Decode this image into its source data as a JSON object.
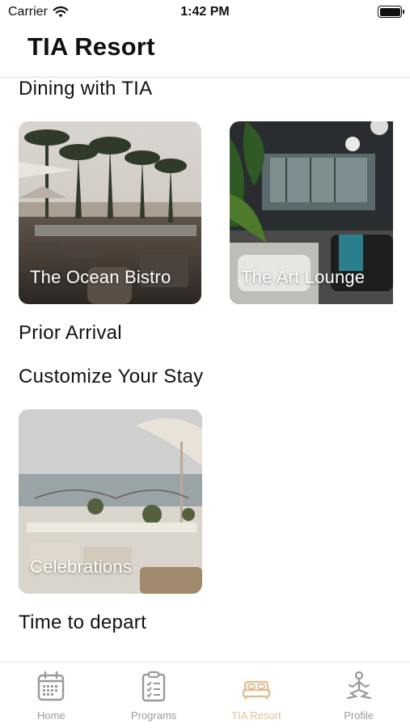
{
  "status_bar": {
    "carrier": "Carrier",
    "time": "1:42 PM"
  },
  "header": {
    "title": "TIA Resort"
  },
  "sections": {
    "dining": {
      "title": "Dining with TIA",
      "cards": [
        {
          "label": "The Ocean Bistro"
        },
        {
          "label": "The Art Lounge"
        }
      ]
    },
    "prior_arrival": {
      "title": "Prior Arrival"
    },
    "customize": {
      "title": "Customize Your Stay",
      "cards": [
        {
          "label": "Celebrations"
        }
      ]
    },
    "depart": {
      "title": "Time to depart"
    }
  },
  "tab_bar": {
    "tabs": [
      {
        "label": "Home",
        "icon": "calendar-icon"
      },
      {
        "label": "Programs",
        "icon": "clipboard-checklist-icon"
      },
      {
        "label": "TIA Resort",
        "icon": "bed-icon",
        "active": true
      },
      {
        "label": "Profile",
        "icon": "meditation-icon"
      }
    ],
    "active_color": "#e2bf97",
    "inactive_color": "#9a9a9a"
  }
}
